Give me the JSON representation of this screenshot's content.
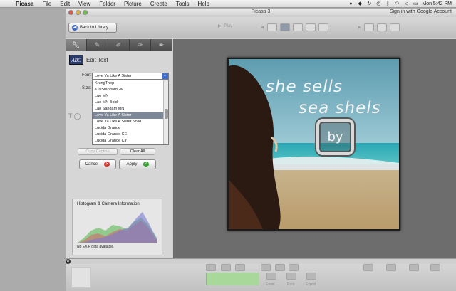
{
  "menubar": {
    "app": "Picasa",
    "items": [
      "File",
      "Edit",
      "View",
      "Folder",
      "Picture",
      "Create",
      "Tools",
      "Help"
    ],
    "clock": "Mon 5:42 PM"
  },
  "window": {
    "title": "Picasa 3",
    "sign_in": "Sign in with Google Account"
  },
  "toolbar": {
    "back_label": "Back to Library",
    "play_label": "Play"
  },
  "panel": {
    "heading": "Edit Text",
    "font_label": "Font:",
    "size_label": "Size:",
    "font_selected": "Love Ya Like A Sister",
    "font_options": [
      "KrungThep",
      "KufiStandardGK",
      "Lao MN",
      "Lao MN Bold",
      "Lao Sangam MN",
      "Love Ya Like A Sister",
      "Love Ya Like A Sister Solid",
      "Lucida Grande",
      "Lucida Grande CE",
      "Lucida Grande CY"
    ],
    "font_selected_index": 5,
    "copy_caption": "Copy Caption",
    "clear_all": "Clear All",
    "cancel": "Cancel",
    "apply": "Apply",
    "histogram_title": "Histogram & Camera Information",
    "no_exif": "No EXIF data available."
  },
  "photo": {
    "line1": "she sells",
    "line2": "sea shels",
    "badge": "by"
  },
  "colors": {
    "accent_blue": "#3c6fd6",
    "cancel_red": "#cd3a36",
    "apply_green": "#3da23a",
    "selection": "#7c8797"
  }
}
